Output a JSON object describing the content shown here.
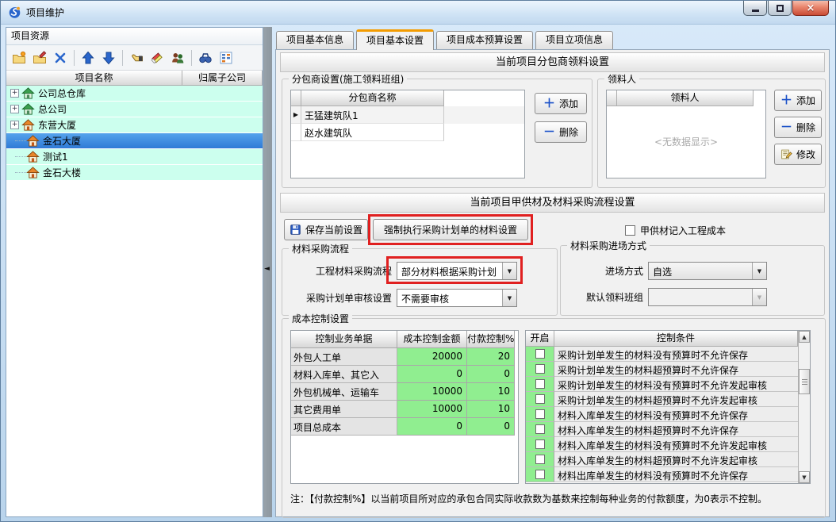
{
  "window": {
    "title": "项目维护"
  },
  "icons": {
    "close": "×",
    "dropdown": "▼",
    "row_marker": "▶",
    "expand": "+",
    "splitter_arrow": "◄",
    "scroll_up": "▲",
    "scroll_down": "▼",
    "plus": "＋",
    "minus": "－"
  },
  "left_panel": {
    "caption": "项目资源",
    "columns": {
      "name": "项目名称",
      "company": "归属子公司"
    },
    "tree_items": [
      {
        "label": "公司总仓库"
      },
      {
        "label": "总公司"
      },
      {
        "label": "东营大厦"
      },
      {
        "label": "金石大厦"
      },
      {
        "label": "测试1"
      },
      {
        "label": "金石大楼"
      }
    ]
  },
  "tabs": {
    "t0": "项目基本信息",
    "t1": "项目基本设置",
    "t2": "项目成本预算设置",
    "t3": "项目立项信息"
  },
  "picking_section": {
    "header": "当前项目分包商领料设置",
    "sub_group": {
      "title": "分包商设置(施工领料班组)",
      "col": "分包商名称",
      "rows": [
        "王猛建筑队1",
        "赵水建筑队"
      ],
      "add": "添加",
      "del": "删除"
    },
    "picker_group": {
      "title": "领料人",
      "col": "领料人",
      "empty": "<无数据显示>",
      "add": "添加",
      "del": "删除",
      "edit": "修改"
    }
  },
  "flow_section": {
    "header": "当前项目甲供材及材料采购流程设置",
    "save_btn": "保存当前设置",
    "force_btn": "强制执行采购计划单的材料设置",
    "jgc_checkbox": "甲供材记入工程成本",
    "flow_group": {
      "title": "材料采购流程",
      "r1_label": "工程材料采购流程",
      "r1_value": "部分材料根据采购计划",
      "r2_label": "采购计划单审核设置",
      "r2_value": "不需要审核"
    },
    "entry_group": {
      "title": "材料采购进场方式",
      "r1_label": "进场方式",
      "r1_value": "自选",
      "r2_label": "默认领料班组",
      "r2_value": ""
    }
  },
  "cost_section": {
    "title": "成本控制设置",
    "doc_table": {
      "h_name": "控制业务单据",
      "h_amount": "成本控制金额",
      "h_pct": "付款控制%",
      "rows": [
        {
          "name": "外包人工单",
          "amount": "20000",
          "pct": "20"
        },
        {
          "name": "材料入库单、其它入",
          "amount": "0",
          "pct": "0"
        },
        {
          "name": "外包机械单、运输车",
          "amount": "10000",
          "pct": "10"
        },
        {
          "name": "其它费用单",
          "amount": "10000",
          "pct": "10"
        },
        {
          "name": "项目总成本",
          "amount": "0",
          "pct": "0"
        }
      ]
    },
    "cond_table": {
      "h_on": "开启",
      "h_cond": "控制条件",
      "rows": [
        "采购计划单发生的材料没有预算时不允许保存",
        "采购计划单发生的材料超预算时不允许保存",
        "采购计划单发生的材料没有预算时不允许发起审核",
        "采购计划单发生的材料超预算时不允许发起审核",
        "材料入库单发生的材料没有预算时不允许保存",
        "材料入库单发生的材料超预算时不允许保存",
        "材料入库单发生的材料没有预算时不允许发起审核",
        "材料入库单发生的材料超预算时不允许发起审核",
        "材料出库单发生的材料没有预算时不允许保存"
      ]
    },
    "note": "注：【付款控制%】以当前项目所对应的承包合同实际收款数为基数来控制每种业务的付款额度，为0表示不控制。"
  },
  "colors": {
    "annotation_red": "#e02020",
    "selection_blue": "#3b92e6",
    "tree_row_cyan": "#ccffee",
    "cell_green": "#90ee90",
    "tab_active_orange": "#f49c00"
  }
}
